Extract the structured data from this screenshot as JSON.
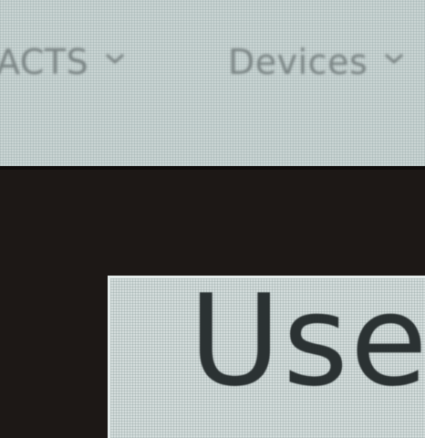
{
  "nav": {
    "items": [
      {
        "label": "ACTS",
        "icon": "chevron-down-icon"
      },
      {
        "label": "Devices",
        "icon": "chevron-down-icon"
      }
    ]
  },
  "primary_button": {
    "label": "Use"
  },
  "colors": {
    "nav_background": "#c9d4d3",
    "nav_text": "#7a8484",
    "dark_band": "#1d1816",
    "button_background": "#d3dcdb",
    "button_text": "#2b3233"
  }
}
